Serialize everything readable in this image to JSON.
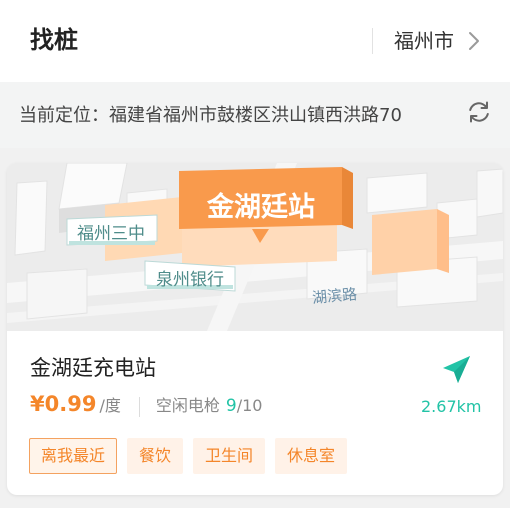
{
  "header": {
    "title": "找桩",
    "city": "福州市"
  },
  "location": {
    "text": "当前定位：福建省福州市鼓楼区洪山镇西洪路70"
  },
  "station": {
    "map_labels": {
      "station": "金湖廷站",
      "building": "福州三中",
      "bank": "泉州银行",
      "road": "湖滨路"
    },
    "name": "金湖廷充电站",
    "price": "¥0.99",
    "price_unit": "/度",
    "idle_label": "空闲电枪",
    "idle_free": "9",
    "idle_slash": "/",
    "idle_total": "10",
    "distance": "2.67km",
    "tags": [
      "离我最近",
      "餐饮",
      "卫生间",
      "休息室"
    ]
  },
  "icons": {
    "city": "chevron-right-icon",
    "refresh": "refresh-icon",
    "navigate": "navigation-arrow-icon"
  },
  "colors": {
    "accent_orange": "#f4862a",
    "accent_teal": "#22c3a6",
    "tag_bg": "#fff2e8"
  }
}
